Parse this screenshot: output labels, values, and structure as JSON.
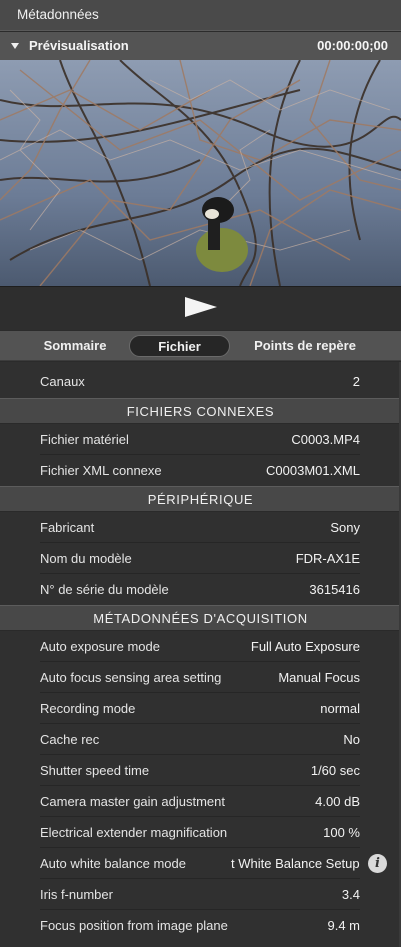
{
  "panel": {
    "title": "Métadonnées"
  },
  "preview": {
    "label": "Prévisualisation",
    "timecode": "00:00:00;00"
  },
  "tabs": [
    {
      "label": "Sommaire",
      "active": false
    },
    {
      "label": "Fichier",
      "active": true
    },
    {
      "label": "Points de repère",
      "active": false
    }
  ],
  "file": {
    "channels": {
      "label": "Canaux",
      "value": "2"
    },
    "related_header": "FICHIERS CONNEXES",
    "related": [
      {
        "label": "Fichier matériel",
        "value": "C0003.MP4"
      },
      {
        "label": "Fichier XML connexe",
        "value": "C0003M01.XML"
      }
    ],
    "device_header": "PÉRIPHÉRIQUE",
    "device": [
      {
        "label": "Fabricant",
        "value": "Sony"
      },
      {
        "label": "Nom du modèle",
        "value": "FDR-AX1E"
      },
      {
        "label": "N° de série du modèle",
        "value": "3615416"
      }
    ],
    "acq_header": "MÉTADONNÉES D'ACQUISITION",
    "acquisition": [
      {
        "label": "Auto exposure mode",
        "value": "Full Auto Exposure"
      },
      {
        "label": "Auto focus sensing area setting",
        "value": "Manual Focus"
      },
      {
        "label": "Recording mode",
        "value": "normal"
      },
      {
        "label": "Cache rec",
        "value": "No"
      },
      {
        "label": "Shutter speed time",
        "value": "1/60 sec"
      },
      {
        "label": "Camera master gain adjustment",
        "value": "4.00 dB"
      },
      {
        "label": "Electrical extender magnification",
        "value": "100 %"
      },
      {
        "label": "Auto white balance mode",
        "value": "t White Balance Setup"
      },
      {
        "label": "Iris f-number",
        "value": "3.4"
      },
      {
        "label": "Focus position from image plane",
        "value": "9.4 m"
      }
    ]
  },
  "icons": {
    "info": "info-icon",
    "play": "play-icon",
    "collapse": "triangle-down-icon"
  }
}
